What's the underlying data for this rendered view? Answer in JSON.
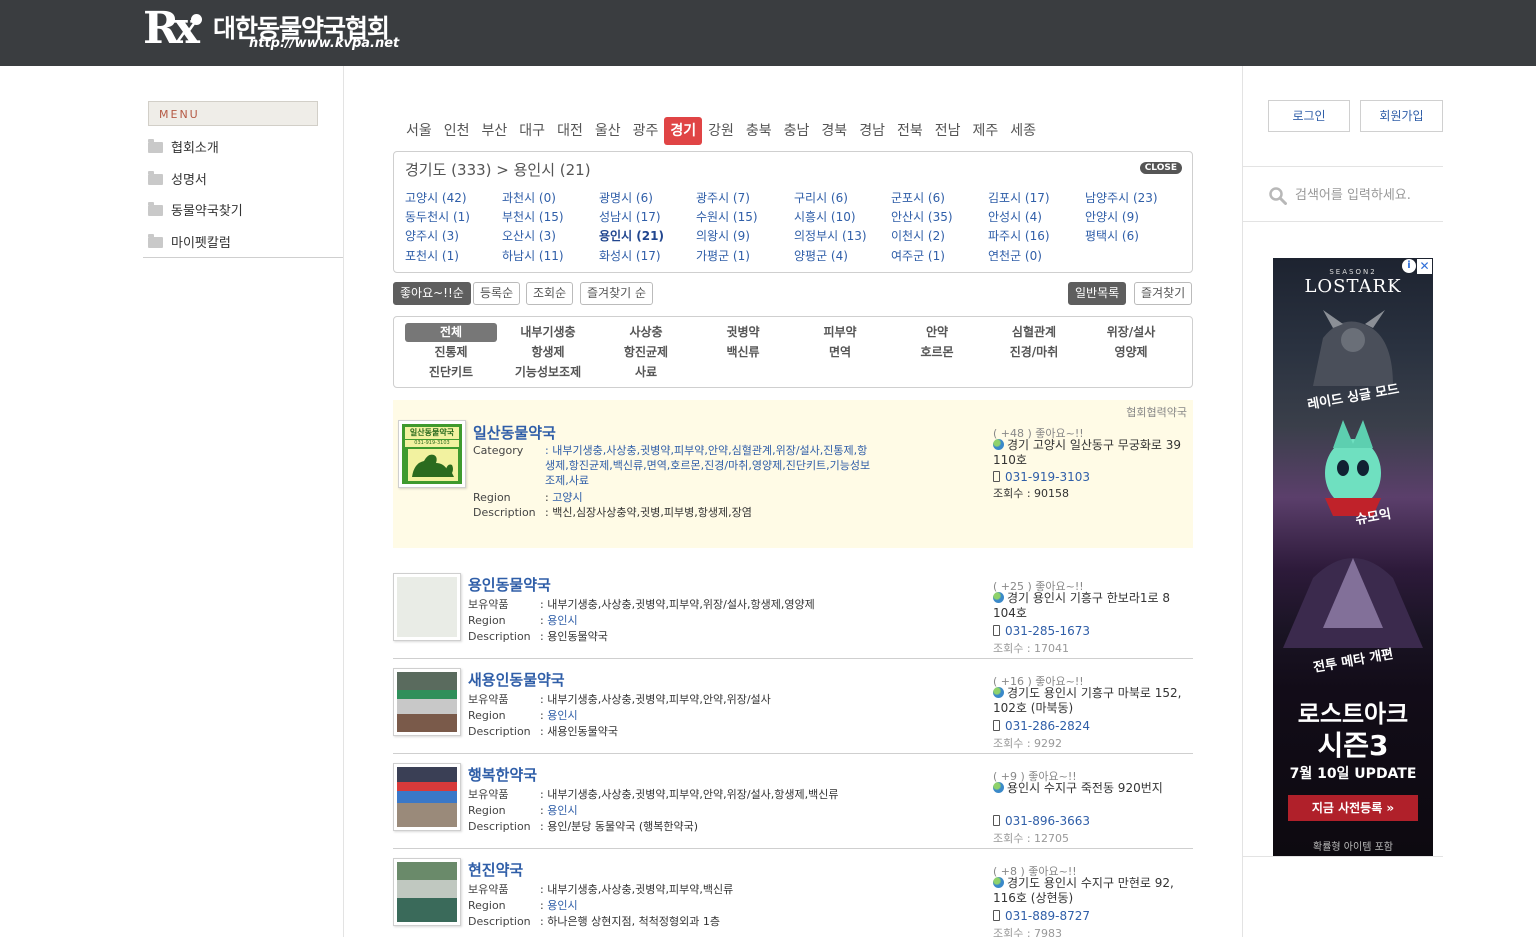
{
  "header": {
    "logo_mark": "Rx",
    "site_name": "대한동물약국협회",
    "url": "http://www.kvpa.net"
  },
  "sidebar": {
    "menu_title": "MENU",
    "items": [
      {
        "label": "협회소개"
      },
      {
        "label": "성명서"
      },
      {
        "label": "동물약국찾기"
      },
      {
        "label": "마이펫칼럼"
      }
    ]
  },
  "regions": [
    "서울",
    "인천",
    "부산",
    "대구",
    "대전",
    "울산",
    "광주",
    "경기",
    "강원",
    "충북",
    "충남",
    "경북",
    "경남",
    "전북",
    "전남",
    "제주",
    "세종"
  ],
  "active_region": "경기",
  "cities": {
    "title": "경기도 (333) > 용인시 (21)",
    "close_label": "CLOSE",
    "items": [
      [
        "고양시 (42)",
        "과천시 (0)",
        "광명시 (6)",
        "광주시 (7)",
        "구리시 (6)",
        "군포시 (6)",
        "김포시 (17)",
        "남양주시 (23)"
      ],
      [
        "동두천시 (1)",
        "부천시 (15)",
        "성남시 (17)",
        "수원시 (15)",
        "시흥시 (10)",
        "안산시 (35)",
        "안성시 (4)",
        "안양시 (9)"
      ],
      [
        "양주시 (3)",
        "오산시 (3)",
        "용인시 (21)",
        "의왕시 (9)",
        "의정부시 (13)",
        "이천시 (2)",
        "파주시 (16)",
        "평택시 (6)"
      ],
      [
        "포천시 (1)",
        "하남시 (11)",
        "화성시 (17)",
        "가평군 (1)",
        "양평군 (4)",
        "여주군 (1)",
        "연천군 (0)"
      ]
    ],
    "selected": "용인시 (21)"
  },
  "sort": {
    "left": [
      {
        "label": "좋아요~!!순",
        "active": true
      },
      {
        "label": "등록순",
        "active": false
      },
      {
        "label": "조회순",
        "active": false
      },
      {
        "label": "즐겨찾기 순",
        "active": false
      }
    ],
    "right": [
      {
        "label": "일반목록",
        "active": true
      },
      {
        "label": "즐겨찾기",
        "active": false
      }
    ]
  },
  "categories": [
    [
      "전체",
      "내부기생충",
      "사상충",
      "귓병약",
      "피부약",
      "안약",
      "심혈관계",
      "위장/설사"
    ],
    [
      "진통제",
      "항생제",
      "항진균제",
      "백신류",
      "면역",
      "호르몬",
      "진경/마취",
      "영양제"
    ],
    [
      "진단키트",
      "기능성보조제",
      "사료"
    ]
  ],
  "active_category": "전체",
  "featured": {
    "partner_label": "협회협력약국",
    "name": "일산동물약국",
    "thumb_text": "일산동물약국",
    "thumb_phone": "031-919-3103",
    "category_label": "Category",
    "category_value": ": 내부기생충,사상충,귓병약,피부약,안약,심혈관계,위장/설사,진통제,항생제,항진균제,백신류,면역,호르몬,진경/마취,영양제,진단키트,기능성보조제,사료",
    "region_label": "Region",
    "region_value": "고양시",
    "desc_label": "Description",
    "desc_value": ": 백신,심장사상충약,귓병,피부병,항생제,장염",
    "likes": "( +48 ) 좋아요~!!",
    "address": "경기 고양시 일산동구 무궁화로 39 110호",
    "phone": "031-919-3103",
    "views": "조회수 : 90158"
  },
  "listings": [
    {
      "name": "용인동물약국",
      "stock_label": "보유약품",
      "stock_value": ": 내부기생충,사상충,귓병약,피부약,위장/설사,항생제,영양제",
      "region_label": "Region",
      "region_value": "용인시",
      "desc_label": "Description",
      "desc_value": ": 용인동물약국",
      "likes": "( +25 ) 좋아요~!!",
      "address": "경기 용인시 기흥구 한보라1로 8 104호",
      "phone": "031-285-1673",
      "views": "조회수 : 17041"
    },
    {
      "name": "새용인동물약국",
      "stock_label": "보유약품",
      "stock_value": ": 내부기생충,사상충,귓병약,피부약,안약,위장/설사",
      "region_label": "Region",
      "region_value": "용인시",
      "desc_label": "Description",
      "desc_value": ": 새용인동물약국",
      "likes": "( +16 ) 좋아요~!!",
      "address": "경기도 용인시 기흥구 마북로 152, 102호 (마북동)",
      "phone": "031-286-2824",
      "views": "조회수 : 9292"
    },
    {
      "name": "행복한약국",
      "stock_label": "보유약품",
      "stock_value": ": 내부기생충,사상충,귓병약,피부약,안약,위장/설사,항생제,백신류",
      "region_label": "Region",
      "region_value": "용인시",
      "desc_label": "Description",
      "desc_value": ": 용인/분당 동물약국 (행복한약국)",
      "likes": "( +9 ) 좋아요~!!",
      "address": "용인시 수지구 죽전동 920번지",
      "phone": "031-896-3663",
      "views": "조회수 : 12705"
    },
    {
      "name": "현진약국",
      "stock_label": "보유약품",
      "stock_value": ": 내부기생충,사상충,귓병약,피부약,백신류",
      "region_label": "Region",
      "region_value": "용인시",
      "desc_label": "Description",
      "desc_value": ": 하나은행 상현지점, 척척정형외과 1층",
      "likes": "( +8 ) 좋아요~!!",
      "address": "경기도 용인시 수지구 만현로 92, 116호 (상현동)",
      "phone": "031-889-8727",
      "views": "조회수 : 7983"
    }
  ],
  "right": {
    "login_label": "로그인",
    "join_label": "회원가입",
    "search_placeholder": "검색어를 입력하세요."
  },
  "ad": {
    "season": "SEASON2",
    "brand": "LOSTARK",
    "line1": "레이드 싱글 모드",
    "line2": "슈모익",
    "line3": "전투 메타 개편",
    "headline1": "로스트아크",
    "headline2": "시즌3",
    "date": "7월 10일 UPDATE",
    "cta": "지금 사전등록 »",
    "footnote": "확률형 아이템 포함",
    "info_symbol": "i",
    "close_symbol": "✕"
  },
  "colors": {
    "header_bg": "#3a3d40",
    "accent_red": "#e04445",
    "link_blue": "#2f5ea8",
    "featured_bg": "#fffbe6"
  }
}
